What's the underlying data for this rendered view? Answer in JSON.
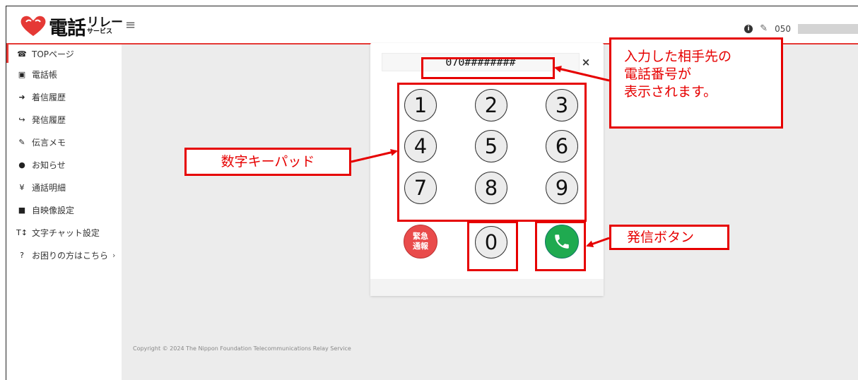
{
  "brand": {
    "main": "電話",
    "sub_a": "リレー",
    "sub_b": "サービス"
  },
  "header": {
    "menu_icon": "hamburger-icon",
    "phone_prefix": "050"
  },
  "sidebar": {
    "items": [
      {
        "icon": "phone-icon",
        "glyph": "☎",
        "label": "TOPページ"
      },
      {
        "icon": "address-book-icon",
        "glyph": "▣",
        "label": "電話帳"
      },
      {
        "icon": "incoming-call-icon",
        "glyph": "➜",
        "label": "着信履歴"
      },
      {
        "icon": "outgoing-call-icon",
        "glyph": "↪",
        "label": "発信履歴"
      },
      {
        "icon": "memo-edit-icon",
        "glyph": "✎",
        "label": "伝言メモ"
      },
      {
        "icon": "info-icon",
        "glyph": "●",
        "label": "お知らせ"
      },
      {
        "icon": "yen-icon",
        "glyph": "¥",
        "label": "通話明細"
      },
      {
        "icon": "video-camera-icon",
        "glyph": "■",
        "label": "自映像設定"
      },
      {
        "icon": "text-size-icon",
        "glyph": "T↕",
        "label": "文字チャット設定"
      },
      {
        "icon": "help-icon",
        "glyph": "?",
        "label": "お困りの方はこちら"
      }
    ]
  },
  "dialer": {
    "number": "070########",
    "keys": [
      "1",
      "2",
      "3",
      "4",
      "5",
      "6",
      "7",
      "8",
      "9"
    ],
    "zero": "0",
    "emergency_line1": "緊急",
    "emergency_line2": "通報",
    "clear": "×"
  },
  "footer": {
    "copyright": "Copyright © 2024 The Nippon Foundation Telecommunications Relay Service"
  },
  "annotations": {
    "number_note": "入力した相手先の\n電話番号が\n表示されます。",
    "keypad_note": "数字キーパッド",
    "call_note": "発信ボタン"
  },
  "colors": {
    "accent": "#e53935",
    "annotation": "#e60000",
    "call_green": "#1faa50",
    "emergency_red": "#e94b4b"
  }
}
